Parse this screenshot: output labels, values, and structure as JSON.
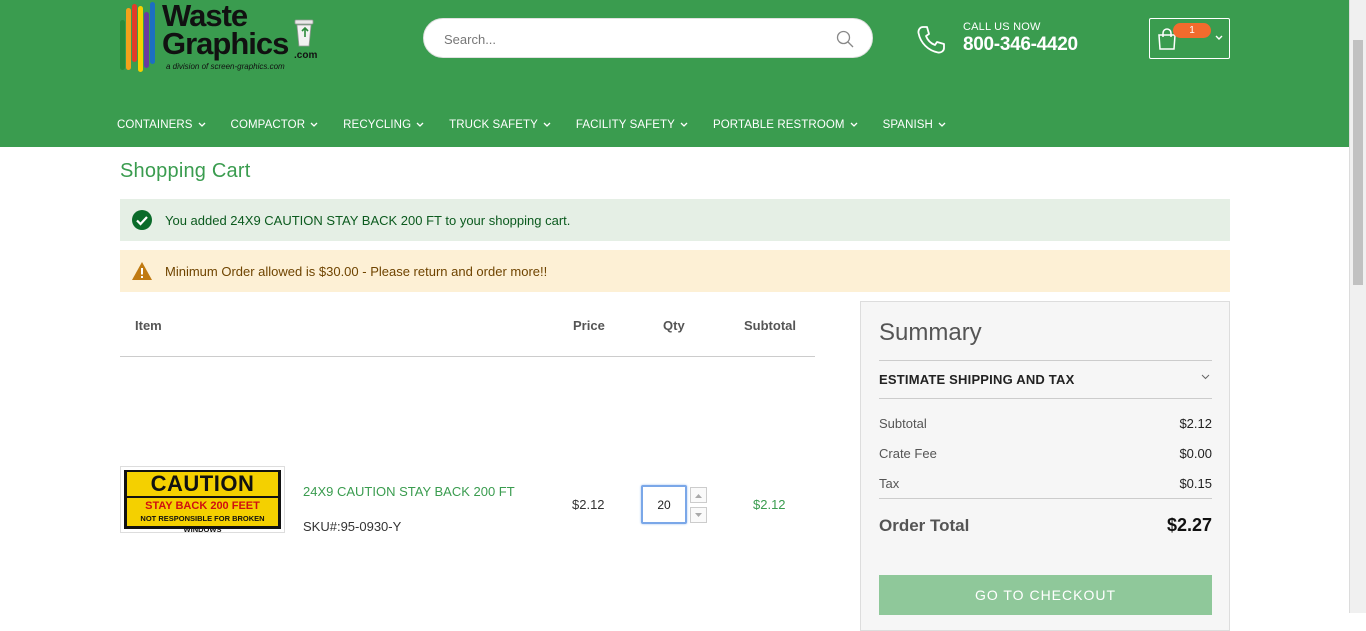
{
  "header": {
    "logo": {
      "line1": "Waste",
      "line2": "Graphics",
      "com": ".com",
      "tagline": "a division of screen-graphics.com"
    },
    "search": {
      "placeholder": "Search..."
    },
    "call": {
      "label": "CALL US NOW",
      "number": "800-346-4420"
    },
    "cart": {
      "count": "1"
    },
    "nav": [
      {
        "label": "CONTAINERS"
      },
      {
        "label": "COMPACTOR"
      },
      {
        "label": "RECYCLING"
      },
      {
        "label": "TRUCK SAFETY"
      },
      {
        "label": "FACILITY SAFETY"
      },
      {
        "label": "PORTABLE RESTROOM"
      },
      {
        "label": "SPANISH"
      }
    ]
  },
  "page": {
    "title": "Shopping Cart",
    "messages": {
      "success": "You added 24X9 CAUTION STAY BACK 200 FT to your shopping cart.",
      "warning": "Minimum Order allowed is $30.00 - Please return and order more!!"
    }
  },
  "cart_table": {
    "headers": {
      "item": "Item",
      "price": "Price",
      "qty": "Qty",
      "subtotal": "Subtotal"
    },
    "items": [
      {
        "image_text": {
          "title": "CAUTION",
          "line1": "STAY BACK 200 FEET",
          "line2": "NOT RESPONSIBLE FOR BROKEN WINDOWS"
        },
        "name": "24X9 CAUTION STAY BACK 200 FT",
        "sku": "SKU#:95-0930-Y",
        "price": "$2.12",
        "qty": "20",
        "subtotal": "$2.12"
      }
    ]
  },
  "summary": {
    "title": "Summary",
    "estimate_label": "ESTIMATE SHIPPING AND TAX",
    "rows": [
      {
        "label": "Subtotal",
        "value": "$2.12"
      },
      {
        "label": "Crate Fee",
        "value": "$0.00"
      },
      {
        "label": "Tax",
        "value": "$0.15"
      }
    ],
    "order_total_label": "Order Total",
    "order_total_value": "$2.27",
    "checkout_label": "GO TO CHECKOUT"
  },
  "colors": {
    "brand_green": "#3a9c4f",
    "checkout_button": "#8fc89a",
    "badge_orange": "#f26b2d",
    "success_bg": "#e5efe5",
    "warning_bg": "#fdf0d5"
  },
  "icons": [
    "search-icon",
    "phone-icon",
    "shopping-bag-icon",
    "chevron-down-icon",
    "check-circle-icon",
    "warning-triangle-icon",
    "trash-bin-icon"
  ]
}
